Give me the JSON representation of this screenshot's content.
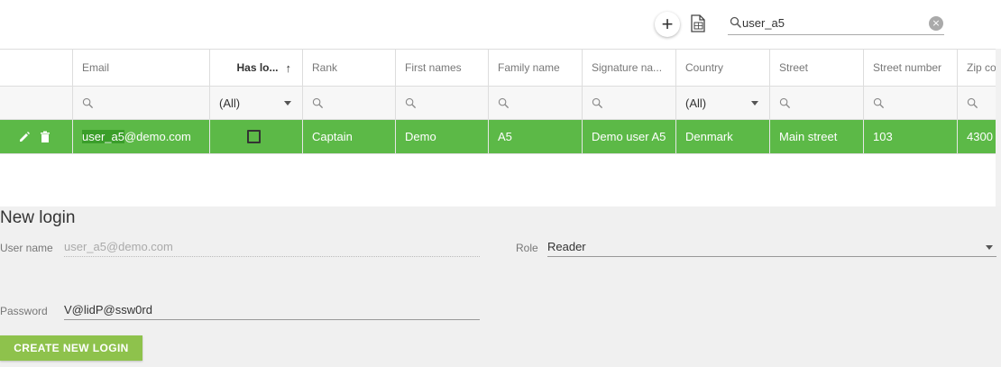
{
  "toolbar": {
    "add_symbol": "+",
    "search_value": "user_a5",
    "clear_symbol": "×"
  },
  "grid": {
    "columns": [
      {
        "key": "actions",
        "label": ""
      },
      {
        "key": "email",
        "label": "Email"
      },
      {
        "key": "has_login",
        "label": "Has lo...",
        "sort": "↑"
      },
      {
        "key": "rank",
        "label": "Rank"
      },
      {
        "key": "first_names",
        "label": "First names"
      },
      {
        "key": "family_name",
        "label": "Family name"
      },
      {
        "key": "signature_name",
        "label": "Signature na..."
      },
      {
        "key": "country",
        "label": "Country"
      },
      {
        "key": "street",
        "label": "Street"
      },
      {
        "key": "street_number",
        "label": "Street number"
      },
      {
        "key": "zip_code",
        "label": "Zip co"
      }
    ],
    "filters": {
      "has_login": "(All)",
      "country": "(All)"
    },
    "rows": [
      {
        "email_match": "user_a5",
        "email_rest": "@demo.com",
        "has_login": false,
        "rank": "Captain",
        "first_names": "Demo",
        "family_name": "A5",
        "signature_name": "Demo user A5",
        "country": "Denmark",
        "street": "Main street",
        "street_number": "103",
        "zip_code": "4300"
      }
    ]
  },
  "login_panel": {
    "title": "New login",
    "username_label": "User name",
    "username_value": "user_a5@demo.com",
    "role_label": "Role",
    "role_value": "Reader",
    "password_label": "Password",
    "password_value": "V@lidP@ssw0rd",
    "create_button": "CREATE NEW LOGIN"
  },
  "colors": {
    "selected_row": "#5cb947",
    "button": "#8ec24c",
    "panel_bg": "#f0f0f0"
  }
}
